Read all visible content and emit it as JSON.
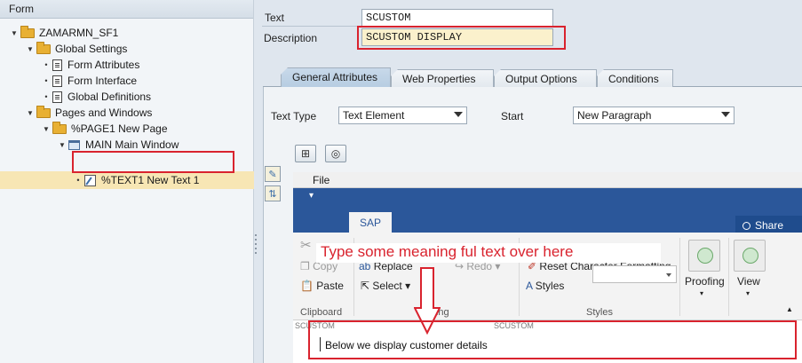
{
  "tree": {
    "header": "Form",
    "nodes": {
      "root": "ZAMARMN_SF1",
      "global_settings": "Global Settings",
      "form_attributes": "Form Attributes",
      "form_interface": "Form Interface",
      "global_definitions": "Global Definitions",
      "pages_windows": "Pages and Windows",
      "page1": "%PAGE1 New Page",
      "main_window": "MAIN Main Window",
      "text1": "%TEXT1 New Text 1"
    }
  },
  "form": {
    "text_label": "Text",
    "text_value": "SCUSTOM",
    "description_label": "Description",
    "description_value": "SCUSTOM DISPLAY"
  },
  "tabs": [
    "General Attributes",
    "Web Properties",
    "Output Options",
    "Conditions"
  ],
  "general": {
    "text_type_label": "Text Type",
    "text_type_value": "Text Element",
    "start_label": "Start",
    "start_value": "New Paragraph"
  },
  "word": {
    "file_menu": "File",
    "qat_icon": "▾",
    "tab": "SAP",
    "share": "Share",
    "copy": "Copy",
    "paste": "Paste",
    "replace": "Replace",
    "select": "Select",
    "redo": "Redo",
    "reset_formatting": "Reset Character Formatting",
    "styles": "Styles",
    "proofing": "Proofing",
    "view": "View",
    "group_clipboard": "Clipboard",
    "group_editing": "Editing",
    "group_styles": "Styles",
    "ghost_left": "SCUSTOM",
    "ghost_right": "SCUSTOM",
    "document_text": "Below we display customer details"
  },
  "annotation": {
    "callout": "Type some meaning ful text over here",
    "color": "#d9232e"
  },
  "colors": {
    "word_blue": "#2b579a",
    "selection": "#f7e6b4"
  }
}
